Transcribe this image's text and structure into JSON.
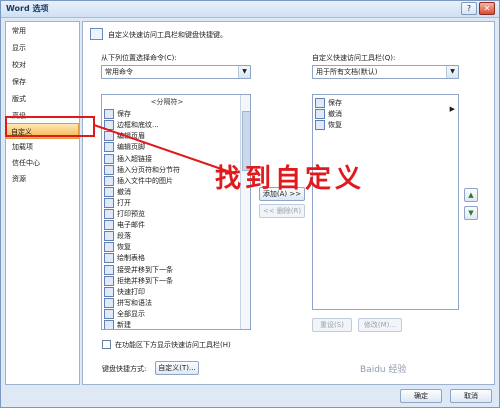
{
  "window": {
    "title": "Word 选项",
    "help": "?",
    "close": "✕"
  },
  "nav": {
    "items": [
      "常用",
      "显示",
      "校对",
      "保存",
      "版式",
      "高级",
      "自定义",
      "加载项",
      "信任中心",
      "资源"
    ],
    "selected_index": 6
  },
  "header": {
    "text": "自定义快速访问工具栏和键盘快捷键。"
  },
  "left_pane": {
    "label": "从下列位置选择命令(C):",
    "combo_value": "常用命令",
    "commands": [
      {
        "label": "<分隔符>",
        "icon": "separator"
      },
      {
        "label": "保存",
        "icon": "save-icon"
      },
      {
        "label": "边框和底纹...",
        "icon": "border-icon"
      },
      {
        "label": "编辑页眉",
        "icon": "header-icon"
      },
      {
        "label": "编辑页脚",
        "icon": "footer-icon"
      },
      {
        "label": "插入超链接",
        "icon": "link-icon"
      },
      {
        "label": "插入分页符和分节符",
        "icon": "break-icon"
      },
      {
        "label": "插入文件中的图片",
        "icon": "picture-icon"
      },
      {
        "label": "撤消",
        "icon": "undo-icon"
      },
      {
        "label": "打开",
        "icon": "open-icon"
      },
      {
        "label": "打印预览",
        "icon": "preview-icon"
      },
      {
        "label": "电子邮件",
        "icon": "email-icon"
      },
      {
        "label": "段落",
        "icon": "paragraph-icon"
      },
      {
        "label": "恢复",
        "icon": "redo-icon"
      },
      {
        "label": "绘制表格",
        "icon": "table-icon"
      },
      {
        "label": "接受并移到下一条",
        "icon": "accept-icon"
      },
      {
        "label": "拒绝并移到下一条",
        "icon": "reject-icon"
      },
      {
        "label": "快速打印",
        "icon": "print-icon"
      },
      {
        "label": "拼写和语法",
        "icon": "spelling-icon"
      },
      {
        "label": "全部显示",
        "icon": "show-all-icon"
      },
      {
        "label": "新建",
        "icon": "new-icon"
      }
    ]
  },
  "middle": {
    "add": "添加(A) >>",
    "remove": "<< 删除(R)"
  },
  "right_pane": {
    "label": "自定义快速访问工具栏(Q):",
    "combo_value": "用于所有文档(默认)",
    "commands": [
      {
        "label": "保存",
        "icon": "save-icon"
      },
      {
        "label": "撤消",
        "icon": "undo-icon"
      },
      {
        "label": "恢复",
        "icon": "redo-icon"
      }
    ],
    "reset": "重设(S)",
    "modify": "修改(M)...",
    "up": "▲",
    "down": "▼"
  },
  "checkbox": {
    "label": "在功能区下方显示快速访问工具栏(H)"
  },
  "shortcut": {
    "label": "键盘快捷方式:",
    "button": "自定义(T)..."
  },
  "footer": {
    "ok": "确定",
    "cancel": "取消"
  },
  "annotation": {
    "text": "找到自定义",
    "color": "#e0191d"
  },
  "watermark": "Baidu 经验"
}
